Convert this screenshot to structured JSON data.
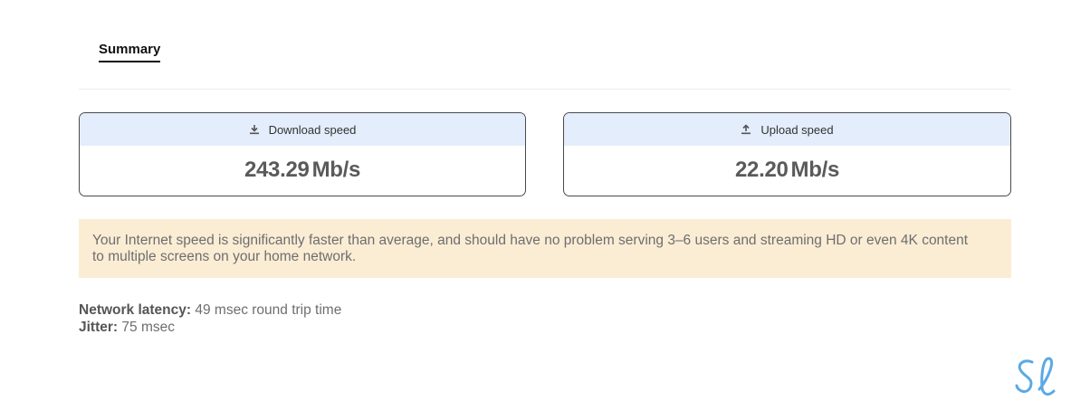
{
  "tabs": [
    {
      "label": "Summary",
      "active": true
    }
  ],
  "download": {
    "label": "Download speed",
    "value": "243.29",
    "unit": "Mb/s",
    "icon": "download-icon"
  },
  "upload": {
    "label": "Upload speed",
    "value": "22.20",
    "unit": "Mb/s",
    "icon": "upload-icon"
  },
  "note": {
    "text": "Your Internet speed is significantly faster than average, and should have no problem serving 3–6 users and streaming HD or even 4K content to multiple screens on your home network."
  },
  "latency": {
    "label": "Network latency:",
    "value": "49 msec round trip time"
  },
  "jitter": {
    "label": "Jitter:",
    "value": "75 msec"
  },
  "logo": {
    "icon": "sl-logo-icon",
    "color": "#5aa9e6"
  },
  "colors": {
    "card_header_bg": "#e3edfb",
    "note_bg": "#fbedd4",
    "card_border": "#4a4a4a"
  }
}
